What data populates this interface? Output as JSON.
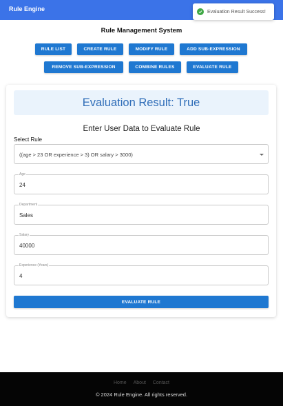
{
  "app": {
    "title": "Rule Engine"
  },
  "toast": {
    "message": "Evaluation Result Success!",
    "icon": "check-circle-icon",
    "color": "#3fa845"
  },
  "page": {
    "title": "Rule Management System"
  },
  "nav_buttons": [
    "RULE LIST",
    "CREATE RULE",
    "MODIFY RULE",
    "ADD SUB-EXPRESSION",
    "REMOVE SUB-EXPRESSION",
    "COMBINE RULES",
    "EVALUATE RULE"
  ],
  "result": {
    "text": "Evaluation Result: True"
  },
  "form": {
    "heading": "Enter User Data to Evaluate Rule",
    "select_label": "Select Rule",
    "selected_rule": "((age > 23 OR experience > 3) OR salary > 3000)",
    "fields": [
      {
        "label": "Age",
        "value": "24"
      },
      {
        "label": "Department",
        "value": "Sales"
      },
      {
        "label": "Salary",
        "value": "40000"
      },
      {
        "label": "Experience (Years)",
        "value": "4"
      }
    ],
    "submit_label": "EVALUATE RULE"
  },
  "footer": {
    "links": [
      "Home",
      "About",
      "Contact"
    ],
    "copyright": "© 2024 Rule Engine. All rights reserved."
  },
  "colors": {
    "appbar": "#3b73e8",
    "primary_button": "#1f78d1",
    "result_text": "#2f6db8",
    "footer": "#050505"
  }
}
